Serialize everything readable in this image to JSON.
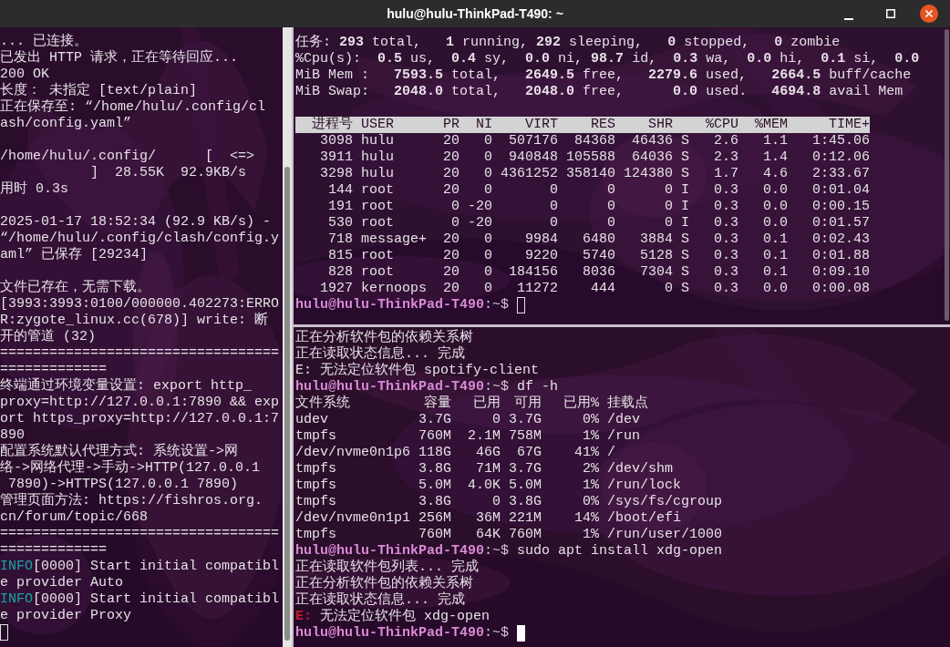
{
  "window": {
    "title": "hulu@hulu-ThinkPad-T490: ~"
  },
  "left_pane": {
    "lines": [
      {
        "kind": "text",
        "text": "... 已连接。"
      },
      {
        "kind": "text",
        "text": "已发出 HTTP 请求，正在等待回应..."
      },
      {
        "kind": "text",
        "text": "200 OK"
      },
      {
        "kind": "text",
        "text": "长度： 未指定 [text/plain]"
      },
      {
        "kind": "text",
        "text": "正在保存至: “/home/hulu/.config/cl"
      },
      {
        "kind": "text",
        "text": "ash/config.yaml”"
      },
      {
        "kind": "blank"
      },
      {
        "kind": "text",
        "text": "/home/hulu/.config/      [  <=>"
      },
      {
        "kind": "text",
        "text": "           ]  28.55K  92.9KB/s"
      },
      {
        "kind": "text",
        "text": "用时 0.3s"
      },
      {
        "kind": "blank"
      },
      {
        "kind": "text",
        "text": "2025-01-17 18:52:34 (92.9 KB/s) -"
      },
      {
        "kind": "text",
        "text": "“/home/hulu/.config/clash/config.y"
      },
      {
        "kind": "text",
        "text": "aml” 已保存 [29234]"
      },
      {
        "kind": "blank"
      },
      {
        "kind": "text",
        "text": "文件已存在，无需下载。"
      },
      {
        "kind": "text",
        "text": "[3993:3993:0100/000000.402273:ERRO"
      },
      {
        "kind": "text",
        "text": "R:zygote_linux.cc(678)] write: 断"
      },
      {
        "kind": "text",
        "text": "开的管道 (32)"
      },
      {
        "kind": "text",
        "text": "=================================="
      },
      {
        "kind": "text",
        "text": "============="
      },
      {
        "kind": "text",
        "text": "终端通过环境变量设置: export http_"
      },
      {
        "kind": "text",
        "text": "proxy=http://127.0.0.1:7890 && exp"
      },
      {
        "kind": "text",
        "text": "ort https_proxy=http://127.0.0.1:7"
      },
      {
        "kind": "text",
        "text": "890"
      },
      {
        "kind": "text",
        "text": "配置系统默认代理方式: 系统设置->网"
      },
      {
        "kind": "text",
        "text": "络->网络代理->手动->HTTP(127.0.0.1"
      },
      {
        "kind": "text",
        "text": " 7890)->HTTPS(127.0.0.1 7890)"
      },
      {
        "kind": "text",
        "text": "管理页面方法: https://fishros.org."
      },
      {
        "kind": "text",
        "text": "cn/forum/topic/668"
      },
      {
        "kind": "text",
        "text": "=================================="
      },
      {
        "kind": "text",
        "text": "============="
      },
      {
        "kind": "info",
        "tag": "INFO",
        "text": "[0000] Start initial compatibl"
      },
      {
        "kind": "text",
        "text": "e provider Auto"
      },
      {
        "kind": "info",
        "tag": "INFO",
        "text": "[0000] Start initial compatibl"
      },
      {
        "kind": "text",
        "text": "e provider Proxy"
      }
    ],
    "cursor": {
      "focused": false
    }
  },
  "top_pane": {
    "lines": [
      {
        "kind": "summary",
        "text": "任务: **293** total,   **1** running, **292** sleeping,   **0** stopped,   **0** zombie"
      },
      {
        "kind": "summary",
        "text": "%Cpu(s):  **0.5** us,  **0.4** sy,  **0.0** ni, **98.7** id,  **0.3** wa,  **0.0** hi,  **0.1** si,  **0.0**"
      },
      {
        "kind": "summary",
        "text": "MiB Mem :   **7593.5** total,   **2649.5** free,   **2279.6** used,   **2664.5** buff/cache"
      },
      {
        "kind": "summary",
        "text": "MiB Swap:   **2048.0** total,   **2048.0** free,      **0.0** used.   **4694.8** avail Mem"
      },
      {
        "kind": "blank"
      },
      {
        "kind": "process_table",
        "columns": [
          "进程号",
          "USER",
          "PR",
          "NI",
          "VIRT",
          "RES",
          "SHR",
          "",
          "%CPU",
          "%MEM",
          "TIME+"
        ],
        "rows": [
          [
            "3098",
            "hulu",
            "20",
            "0",
            "507176",
            "84368",
            "46436",
            "S",
            "2.6",
            "1.1",
            "1:45.06"
          ],
          [
            "3911",
            "hulu",
            "20",
            "0",
            "940848",
            "105588",
            "64036",
            "S",
            "2.3",
            "1.4",
            "0:12.06"
          ],
          [
            "3298",
            "hulu",
            "20",
            "0",
            "4361252",
            "358140",
            "124380",
            "S",
            "1.7",
            "4.6",
            "2:33.67"
          ],
          [
            "144",
            "root",
            "20",
            "0",
            "0",
            "0",
            "0",
            "I",
            "0.3",
            "0.0",
            "0:01.04"
          ],
          [
            "191",
            "root",
            "0",
            "-20",
            "0",
            "0",
            "0",
            "I",
            "0.3",
            "0.0",
            "0:00.15"
          ],
          [
            "530",
            "root",
            "0",
            "-20",
            "0",
            "0",
            "0",
            "I",
            "0.3",
            "0.0",
            "0:01.57"
          ],
          [
            "718",
            "message+",
            "20",
            "0",
            "9984",
            "6480",
            "3884",
            "S",
            "0.3",
            "0.1",
            "0:02.43"
          ],
          [
            "815",
            "root",
            "20",
            "0",
            "9220",
            "5740",
            "5128",
            "S",
            "0.3",
            "0.1",
            "0:01.88"
          ],
          [
            "828",
            "root",
            "20",
            "0",
            "184156",
            "8036",
            "7304",
            "S",
            "0.3",
            "0.1",
            "0:09.10"
          ],
          [
            "1927",
            "kernoops",
            "20",
            "0",
            "11272",
            "444",
            "0",
            "S",
            "0.3",
            "0.0",
            "0:00.08"
          ]
        ]
      },
      {
        "kind": "prompt",
        "user_host": "hulu@hulu-ThinkPad-T490",
        "path": ":~$"
      }
    ],
    "cursor": {
      "focused": false
    }
  },
  "bottom_pane": {
    "lines": [
      {
        "kind": "text",
        "text": "正在分析软件包的依赖关系树"
      },
      {
        "kind": "text",
        "text": "正在读取状态信息... 完成"
      },
      {
        "kind": "text",
        "text": "E: 无法定位软件包 spotify-client"
      },
      {
        "kind": "prompt",
        "user_host": "hulu@hulu-ThinkPad-T490",
        "path": ":~$",
        "command": "df -h"
      },
      {
        "kind": "disk_table",
        "columns": [
          "文件系统",
          "容量",
          "已用",
          "可用",
          "已用%",
          "挂载点"
        ],
        "rows": [
          [
            "udev",
            "3.7G",
            "0",
            "3.7G",
            "0%",
            "/dev"
          ],
          [
            "tmpfs",
            "760M",
            "2.1M",
            "758M",
            "1%",
            "/run"
          ],
          [
            "/dev/nvme0n1p6",
            "118G",
            "46G",
            "67G",
            "41%",
            "/"
          ],
          [
            "tmpfs",
            "3.8G",
            "71M",
            "3.7G",
            "2%",
            "/dev/shm"
          ],
          [
            "tmpfs",
            "5.0M",
            "4.0K",
            "5.0M",
            "1%",
            "/run/lock"
          ],
          [
            "tmpfs",
            "3.8G",
            "0",
            "3.8G",
            "0%",
            "/sys/fs/cgroup"
          ],
          [
            "/dev/nvme0n1p1",
            "256M",
            "36M",
            "221M",
            "14%",
            "/boot/efi"
          ],
          [
            "tmpfs",
            "760M",
            "64K",
            "760M",
            "1%",
            "/run/user/1000"
          ]
        ]
      },
      {
        "kind": "prompt",
        "user_host": "hulu@hulu-ThinkPad-T490",
        "path": ":~$",
        "command": "sudo apt install xdg-open"
      },
      {
        "kind": "text",
        "text": "正在读取软件包列表... 完成"
      },
      {
        "kind": "text",
        "text": "正在分析软件包的依赖关系树"
      },
      {
        "kind": "text",
        "text": "正在读取状态信息... 完成"
      },
      {
        "kind": "error",
        "tag": "E:",
        "text": " 无法定位软件包 xdg-open"
      },
      {
        "kind": "prompt",
        "user_host": "hulu@hulu-ThinkPad-T490",
        "path": ":~$"
      }
    ],
    "cursor": {
      "focused": true
    }
  }
}
